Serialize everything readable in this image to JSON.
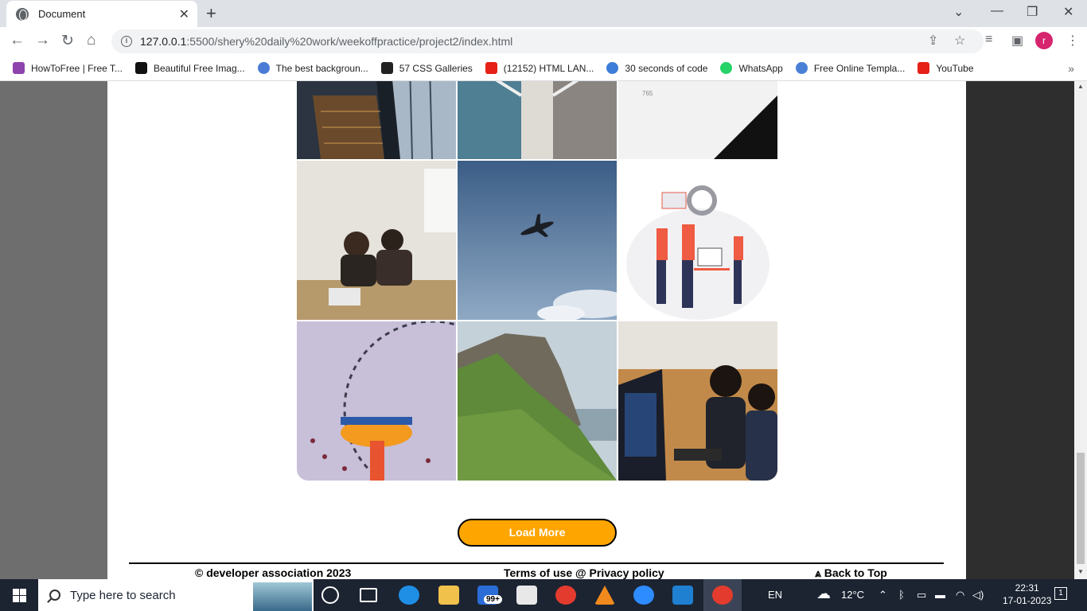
{
  "browser": {
    "tab_title": "Document",
    "url_host": "127.0.0.1",
    "url_rest": ":5500/shery%20daily%20work/weekoffpractice/project2/index.html",
    "profile_initial": "r",
    "bookmarks": [
      {
        "label": "HowToFree | Free T...",
        "color": "#8e44ad"
      },
      {
        "label": "Beautiful Free Imag...",
        "color": "#111111"
      },
      {
        "label": "The best backgroun...",
        "color": "#4b7bd6"
      },
      {
        "label": "57 CSS Galleries",
        "color": "#222222"
      },
      {
        "label": "(12152) HTML LAN...",
        "color": "#e62117"
      },
      {
        "label": "30 seconds of code",
        "color": "#3b7dd8"
      },
      {
        "label": "WhatsApp",
        "color": "#25d366"
      },
      {
        "label": "Free Online Templa...",
        "color": "#4a7fd6"
      },
      {
        "label": "YouTube",
        "color": "#e62117"
      }
    ]
  },
  "page": {
    "load_more": "Load More",
    "footer": {
      "copyright": "© developer association 2023",
      "terms": "Terms of use @ Privacy policy",
      "back_to_top": "⩓ Back to Top"
    },
    "accent_color": "#ffa500"
  },
  "taskbar": {
    "search_placeholder": "Type here to search",
    "language": "EN",
    "temperature": "12°C",
    "time": "22:31",
    "date": "17-01-2023",
    "mail_badge": "99+",
    "notification_count": "1"
  }
}
